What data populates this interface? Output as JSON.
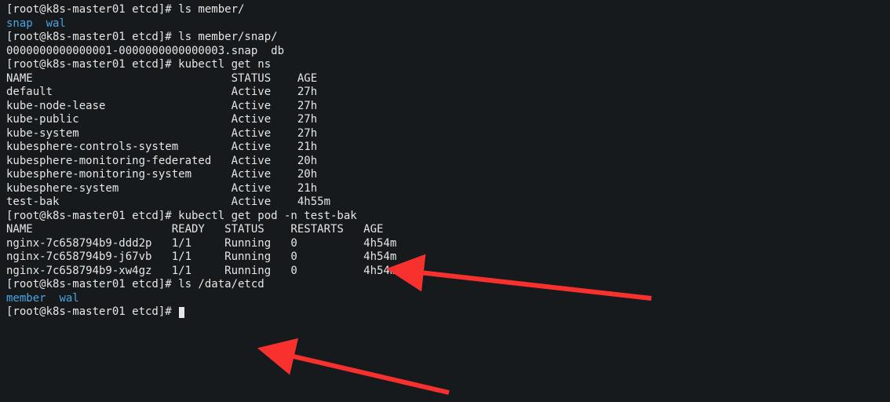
{
  "prompt": "[root@k8s-master01 etcd]# ",
  "cmds": {
    "c1": "ls member/",
    "c2": "ls member/snap/",
    "c3": "kubectl get ns",
    "c4": "kubectl get pod -n test-bak",
    "c5": "ls /data/etcd"
  },
  "out_member": {
    "a": "snap",
    "b": "wal"
  },
  "out_snap": "0000000000000001-0000000000000003.snap  db",
  "ns_header": {
    "name": "NAME",
    "status": "STATUS",
    "age": "AGE"
  },
  "ns_rows": [
    {
      "name": "default",
      "status": "Active",
      "age": "27h"
    },
    {
      "name": "kube-node-lease",
      "status": "Active",
      "age": "27h"
    },
    {
      "name": "kube-public",
      "status": "Active",
      "age": "27h"
    },
    {
      "name": "kube-system",
      "status": "Active",
      "age": "27h"
    },
    {
      "name": "kubesphere-controls-system",
      "status": "Active",
      "age": "21h"
    },
    {
      "name": "kubesphere-monitoring-federated",
      "status": "Active",
      "age": "20h"
    },
    {
      "name": "kubesphere-monitoring-system",
      "status": "Active",
      "age": "20h"
    },
    {
      "name": "kubesphere-system",
      "status": "Active",
      "age": "21h"
    },
    {
      "name": "test-bak",
      "status": "Active",
      "age": "4h55m"
    }
  ],
  "pod_header": {
    "name": "NAME",
    "ready": "READY",
    "status": "STATUS",
    "restarts": "RESTARTS",
    "age": "AGE"
  },
  "pod_rows": [
    {
      "name": "nginx-7c658794b9-ddd2p",
      "ready": "1/1",
      "status": "Running",
      "restarts": "0",
      "age": "4h54m"
    },
    {
      "name": "nginx-7c658794b9-j67vb",
      "ready": "1/1",
      "status": "Running",
      "restarts": "0",
      "age": "4h54m"
    },
    {
      "name": "nginx-7c658794b9-xw4gz",
      "ready": "1/1",
      "status": "Running",
      "restarts": "0",
      "age": "4h54m"
    }
  ],
  "out_data_etcd": {
    "a": "member",
    "b": "wal"
  },
  "arrow_color": "#f8312f",
  "cols": {
    "ns_name": 34,
    "ns_status": 10,
    "pod_name": 25,
    "pod_ready": 8,
    "pod_status": 10,
    "pod_restarts": 11
  }
}
